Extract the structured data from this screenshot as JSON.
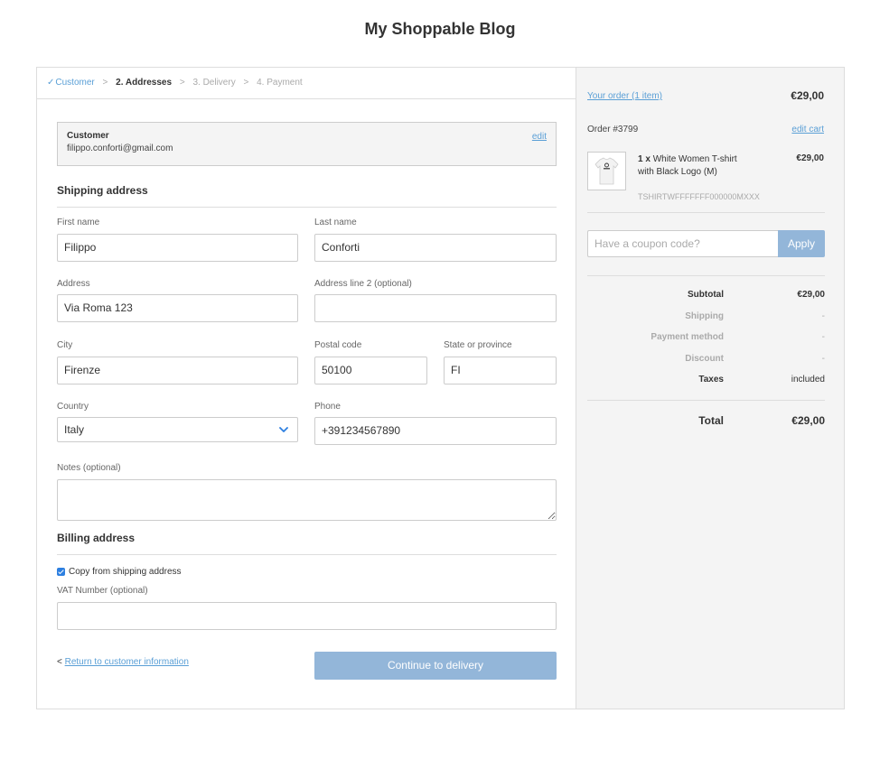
{
  "site": {
    "title": "My Shoppable Blog"
  },
  "steps": {
    "customer": "Customer",
    "addresses": "2. Addresses",
    "delivery": "3. Delivery",
    "payment": "4. Payment",
    "separator": ">"
  },
  "customer": {
    "label": "Customer",
    "email": "filippo.conforti@gmail.com",
    "edit_label": "edit"
  },
  "shipping": {
    "title": "Shipping address",
    "first_name": {
      "label": "First name",
      "value": "Filippo"
    },
    "last_name": {
      "label": "Last name",
      "value": "Conforti"
    },
    "address": {
      "label": "Address",
      "value": "Via Roma 123"
    },
    "address2": {
      "label": "Address line 2 (optional)",
      "value": ""
    },
    "city": {
      "label": "City",
      "value": "Firenze"
    },
    "postal_code": {
      "label": "Postal code",
      "value": "50100"
    },
    "state": {
      "label": "State or province",
      "value": "FI"
    },
    "country": {
      "label": "Country",
      "value": "Italy"
    },
    "phone": {
      "label": "Phone",
      "value": "+391234567890"
    },
    "notes": {
      "label": "Notes (optional)",
      "value": ""
    }
  },
  "billing": {
    "title": "Billing address",
    "copy_label": "Copy from shipping address",
    "copy_checked": true,
    "vat": {
      "label": "VAT Number (optional)",
      "value": ""
    }
  },
  "actions": {
    "back_prefix": "<",
    "back_label": "Return to customer information",
    "continue_label": "Continue to delivery"
  },
  "order": {
    "your_order_label": "Your order (1 item)",
    "total_header": "€29,00",
    "order_number": "Order #3799",
    "edit_cart_label": "edit cart",
    "item": {
      "quantity": "1 x",
      "name": "White Women T-shirt with Black Logo (M)",
      "sku": "TSHIRTWFFFFFFF000000MXXX",
      "price": "€29,00",
      "thumbnail_icon": "tshirt-icon"
    },
    "coupon": {
      "placeholder": "Have a coupon code?",
      "apply_label": "Apply"
    },
    "summary": {
      "subtotal_label": "Subtotal",
      "subtotal_value": "€29,00",
      "shipping_label": "Shipping",
      "shipping_value": "-",
      "payment_label": "Payment method",
      "payment_value": "-",
      "discount_label": "Discount",
      "discount_value": "-",
      "taxes_label": "Taxes",
      "taxes_value": "included",
      "total_label": "Total",
      "total_value": "€29,00"
    }
  },
  "colors": {
    "accent": "#5a9fd6",
    "button": "#93b6d9",
    "checkbox": "#2d7fe0",
    "sidebar_bg": "#f4f4f4"
  }
}
